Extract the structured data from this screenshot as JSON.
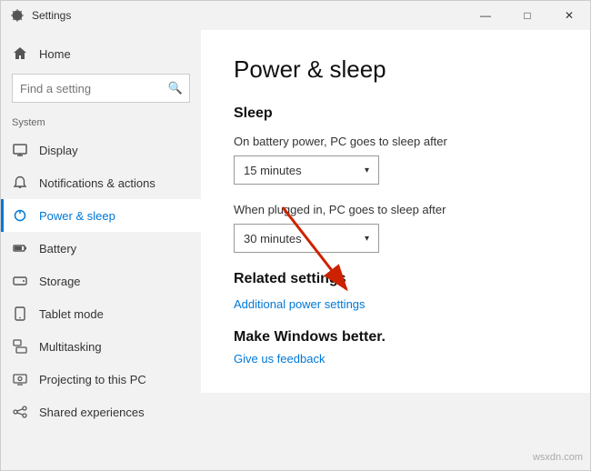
{
  "window": {
    "title": "Settings",
    "controls": {
      "minimize": "—",
      "maximize": "□",
      "close": "✕"
    }
  },
  "sidebar": {
    "search_placeholder": "Find a setting",
    "section_label": "System",
    "items": [
      {
        "id": "home",
        "label": "Home",
        "icon": "home"
      },
      {
        "id": "display",
        "label": "Display",
        "icon": "display"
      },
      {
        "id": "notifications",
        "label": "Notifications & actions",
        "icon": "notifications"
      },
      {
        "id": "power-sleep",
        "label": "Power & sleep",
        "icon": "power",
        "active": true
      },
      {
        "id": "battery",
        "label": "Battery",
        "icon": "battery"
      },
      {
        "id": "storage",
        "label": "Storage",
        "icon": "storage"
      },
      {
        "id": "tablet-mode",
        "label": "Tablet mode",
        "icon": "tablet"
      },
      {
        "id": "multitasking",
        "label": "Multitasking",
        "icon": "multitasking"
      },
      {
        "id": "projecting",
        "label": "Projecting to this PC",
        "icon": "projecting"
      },
      {
        "id": "shared-experiences",
        "label": "Shared experiences",
        "icon": "shared"
      }
    ]
  },
  "main": {
    "page_title": "Power & sleep",
    "sleep_section": {
      "title": "Sleep",
      "battery_label": "On battery power, PC goes to sleep after",
      "battery_value": "15 minutes",
      "plugged_label": "When plugged in, PC goes to sleep after",
      "plugged_value": "30 minutes"
    },
    "related_section": {
      "title": "Related settings",
      "link_text": "Additional power settings"
    },
    "make_better": {
      "title": "Make Windows better.",
      "link_text": "Give us feedback"
    }
  },
  "watermark": "wsxdn.com"
}
